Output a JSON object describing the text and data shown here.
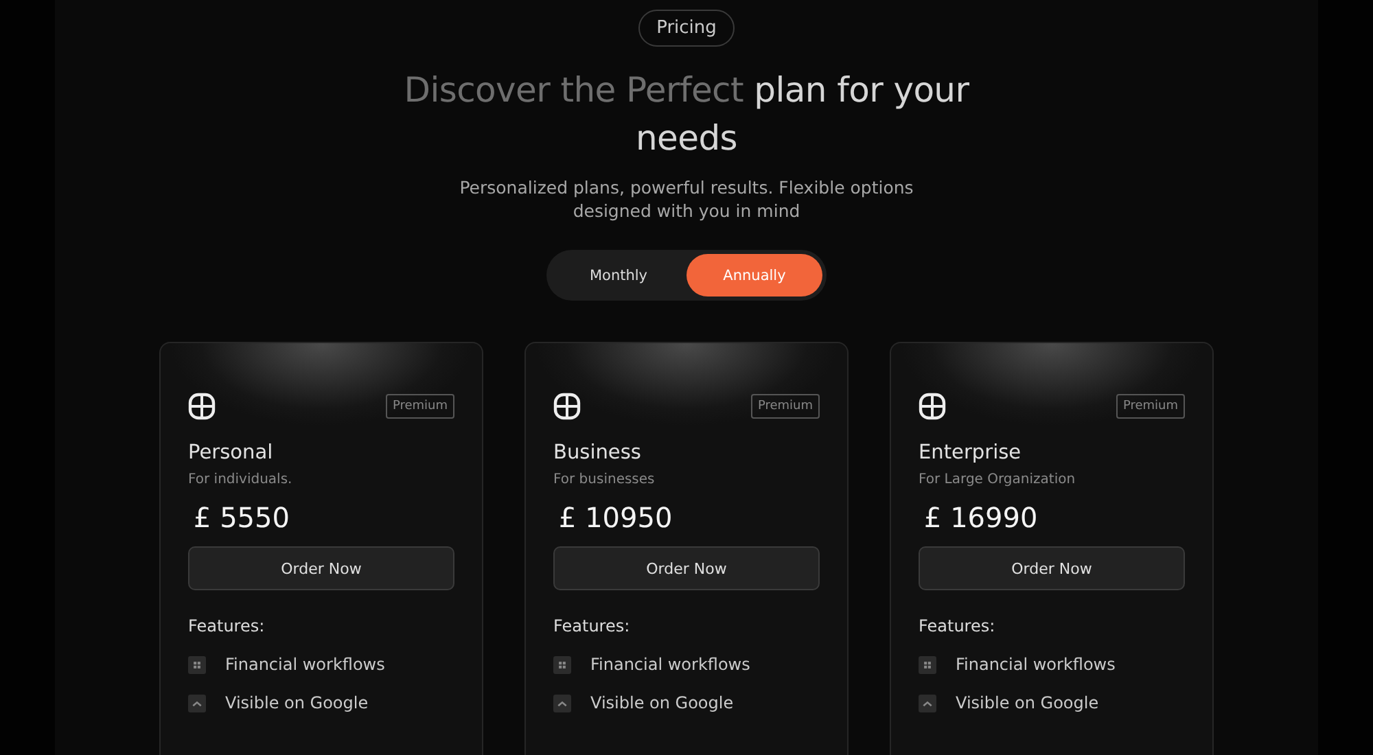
{
  "badge": "Pricing",
  "heading": {
    "dim": "Discover the Perfect",
    "bright": "plan for your needs"
  },
  "subtitle": "Personalized plans, powerful results. Flexible options designed with you in mind",
  "billing_toggle": [
    {
      "label": "Monthly",
      "selected": false
    },
    {
      "label": "Annually",
      "selected": true
    }
  ],
  "plans": [
    {
      "name": "Personal",
      "tag": "Premium",
      "audience": "For individuals.",
      "price": "£ 5550",
      "button": "Order Now",
      "features_heading": "Features:",
      "features": [
        {
          "kind": "grid",
          "label": "Financial workflows"
        },
        {
          "kind": "chevron",
          "label": "Visible on Google"
        }
      ]
    },
    {
      "name": "Business",
      "tag": "Premium",
      "audience": "For businesses",
      "price": "£ 10950",
      "button": "Order Now",
      "features_heading": "Features:",
      "features": [
        {
          "kind": "grid",
          "label": "Financial workflows"
        },
        {
          "kind": "chevron",
          "label": "Visible on Google"
        }
      ]
    },
    {
      "name": "Enterprise",
      "tag": "Premium",
      "audience": "For Large Organization",
      "price": "£ 16990",
      "button": "Order Now",
      "features_heading": "Features:",
      "features": [
        {
          "kind": "grid",
          "label": "Financial workflows"
        },
        {
          "kind": "chevron",
          "label": "Visible on Google"
        }
      ]
    }
  ]
}
